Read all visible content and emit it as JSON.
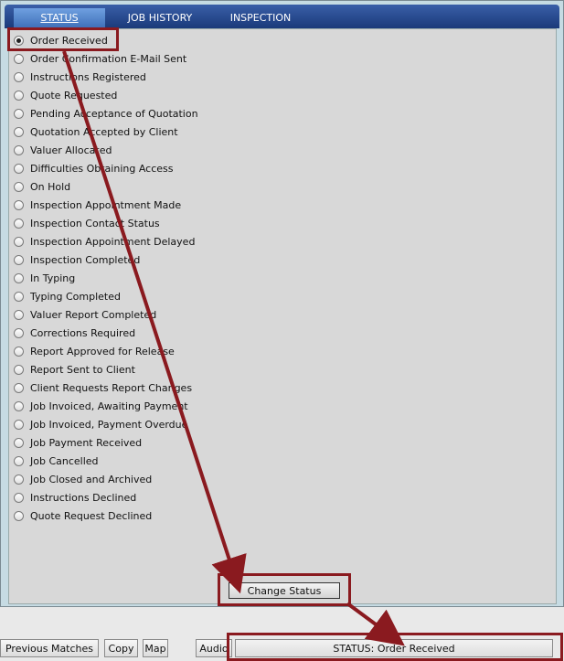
{
  "tabs": [
    {
      "label": "STATUS",
      "active": true
    },
    {
      "label": "JOB HISTORY",
      "active": false
    },
    {
      "label": "INSPECTION",
      "active": false
    }
  ],
  "status_options": [
    {
      "label": "Order Received",
      "checked": true
    },
    {
      "label": "Order Confirmation E-Mail Sent",
      "checked": false
    },
    {
      "label": "Instructions Registered",
      "checked": false
    },
    {
      "label": "Quote Requested",
      "checked": false
    },
    {
      "label": "Pending Acceptance of Quotation",
      "checked": false
    },
    {
      "label": "Quotation Accepted by Client",
      "checked": false
    },
    {
      "label": "Valuer Allocated",
      "checked": false
    },
    {
      "label": "Difficulties Obtaining Access",
      "checked": false
    },
    {
      "label": "On Hold",
      "checked": false
    },
    {
      "label": "Inspection Appointment Made",
      "checked": false
    },
    {
      "label": "Inspection Contact Status",
      "checked": false
    },
    {
      "label": "Inspection Appointment Delayed",
      "checked": false
    },
    {
      "label": "Inspection Completed",
      "checked": false
    },
    {
      "label": "In Typing",
      "checked": false
    },
    {
      "label": "Typing Completed",
      "checked": false
    },
    {
      "label": "Valuer Report Completed",
      "checked": false
    },
    {
      "label": "Corrections Required",
      "checked": false
    },
    {
      "label": "Report Approved for Release",
      "checked": false
    },
    {
      "label": "Report Sent to Client",
      "checked": false
    },
    {
      "label": "Client Requests Report Changes",
      "checked": false
    },
    {
      "label": "Job Invoiced, Awaiting Payment",
      "checked": false
    },
    {
      "label": "Job Invoiced, Payment Overdue",
      "checked": false
    },
    {
      "label": "Job Payment Received",
      "checked": false
    },
    {
      "label": "Job Cancelled",
      "checked": false
    },
    {
      "label": "Job Closed and Archived",
      "checked": false
    },
    {
      "label": "Instructions Declined",
      "checked": false
    },
    {
      "label": "Quote Request Declined",
      "checked": false
    }
  ],
  "change_status_label": "Change Status",
  "bottom_bar": {
    "previous_matches": "Previous Matches",
    "copy": "Copy",
    "map": "Map",
    "audio": "Audio",
    "status_text": "STATUS: Order Received"
  },
  "colors": {
    "annotation": "#8a1a1f",
    "tab_bar": "#1a3a7a"
  }
}
